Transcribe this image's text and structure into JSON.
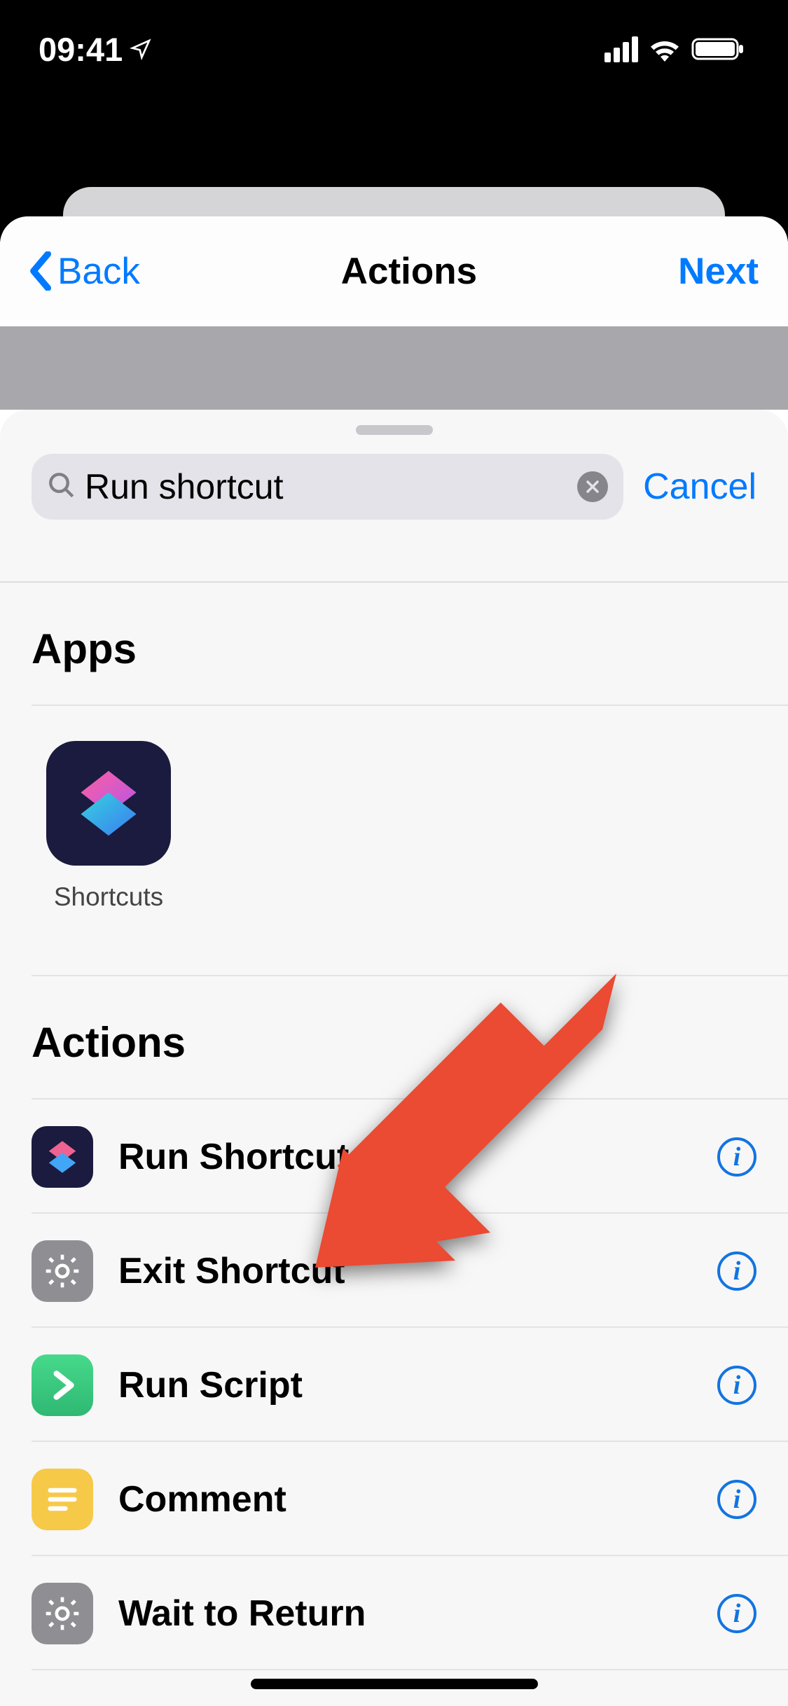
{
  "status": {
    "time": "09:41"
  },
  "nav": {
    "back": "Back",
    "title": "Actions",
    "next": "Next"
  },
  "search": {
    "value": "Run shortcut",
    "cancel": "Cancel"
  },
  "sections": {
    "apps": "Apps",
    "actions": "Actions"
  },
  "apps": [
    {
      "name": "Shortcuts"
    }
  ],
  "actions": [
    {
      "label": "Run Shortcut",
      "icon": "shortcuts"
    },
    {
      "label": "Exit Shortcut",
      "icon": "gear-gray"
    },
    {
      "label": "Run Script",
      "icon": "play-green"
    },
    {
      "label": "Comment",
      "icon": "lines-yellow"
    },
    {
      "label": "Wait to Return",
      "icon": "gear-gray"
    }
  ],
  "colors": {
    "accent": "#007aff",
    "arrow": "#eb4a33"
  }
}
